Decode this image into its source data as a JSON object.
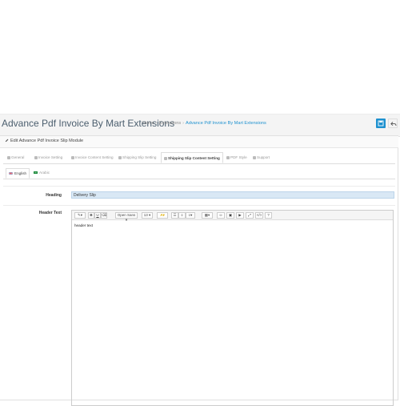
{
  "page": {
    "title": "Advance Pdf Invoice By Mart Extensions",
    "breadcrumb": [
      "Home",
      "Extensions",
      "Advance Pdf Invoice By Mart Extensions"
    ]
  },
  "panel": {
    "title": "Edit Advance Pdf Invoice Slip Module"
  },
  "tabs": [
    {
      "label": "General",
      "icon": "gear-icon"
    },
    {
      "label": "Invoice Setting",
      "icon": "file-icon"
    },
    {
      "label": "Invoice Content Setting",
      "icon": "file-text-icon"
    },
    {
      "label": "Shipping Slip Setting",
      "icon": "truck-icon"
    },
    {
      "label": "Shipping Slip Content Setting",
      "icon": "truck-text-icon",
      "active": true
    },
    {
      "label": "PDF Style",
      "icon": "pdf-icon"
    },
    {
      "label": "Support",
      "icon": "support-icon"
    }
  ],
  "languages": [
    {
      "label": "English",
      "active": true
    },
    {
      "label": "Arabic"
    }
  ],
  "form": {
    "heading_label": "Heading",
    "heading_value": "Delivery Slip",
    "header_text_label": "Header Text"
  },
  "editor": {
    "font_name": "Open Sans",
    "font_size": "13",
    "content": "header text"
  },
  "colors": {
    "accent": "#1e91cf",
    "input_bg": "#d9e8f5"
  }
}
